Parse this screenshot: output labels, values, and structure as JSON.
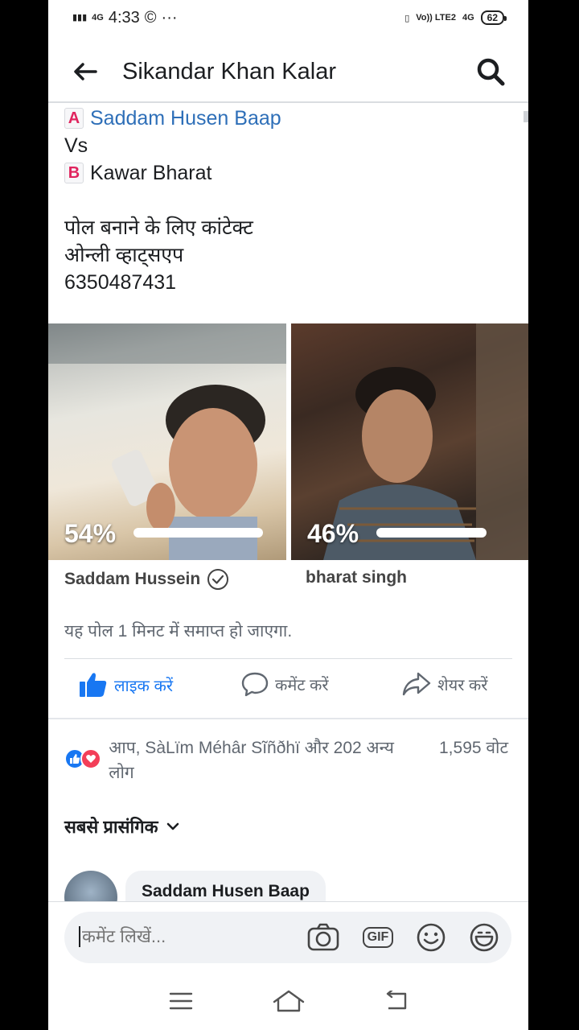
{
  "status_bar": {
    "signal_left": "G",
    "network": "4G",
    "time": "4:33",
    "dots": "···",
    "volte": "Vo)) LTE2",
    "net_right": "4G",
    "battery": "62"
  },
  "header": {
    "title": "Sikandar Khan Kalar"
  },
  "post": {
    "option_a_badge": "A",
    "option_a": "Saddam Husen Baap",
    "vs": "Vs",
    "option_b_badge": "B",
    "option_b": "Kawar Bharat",
    "line1": "पोल बनाने के लिए कांटेक्ट",
    "line2": "ओन्ली व्हाट्सएप",
    "phone": "6350487431"
  },
  "poll": {
    "a": {
      "percent_label": "54%",
      "percent": 54,
      "name": "Saddam Hussein"
    },
    "b": {
      "percent_label": "46%",
      "percent": 46,
      "name": "bharat singh"
    },
    "ends_note": "यह पोल 1 मिनट में समाप्त हो जाएगा."
  },
  "actions": {
    "like": "लाइक करें",
    "comment": "कमेंट करें",
    "share": "शेयर करें"
  },
  "reactions": {
    "text": "आप, SàLïm Méhâr Sĩñðhï और 202 अन्य लोग",
    "votes": "1,595 वोट"
  },
  "comments": {
    "sort_label": "सबसे प्रासंगिक",
    "first_author": "Saddam Husen Baap"
  },
  "composer": {
    "placeholder": "कमेंट लिखें...",
    "gif_label": "GIF"
  },
  "colors": {
    "brand_blue": "#1877f2",
    "link_blue": "#2e6fb8",
    "muted": "#606770"
  }
}
